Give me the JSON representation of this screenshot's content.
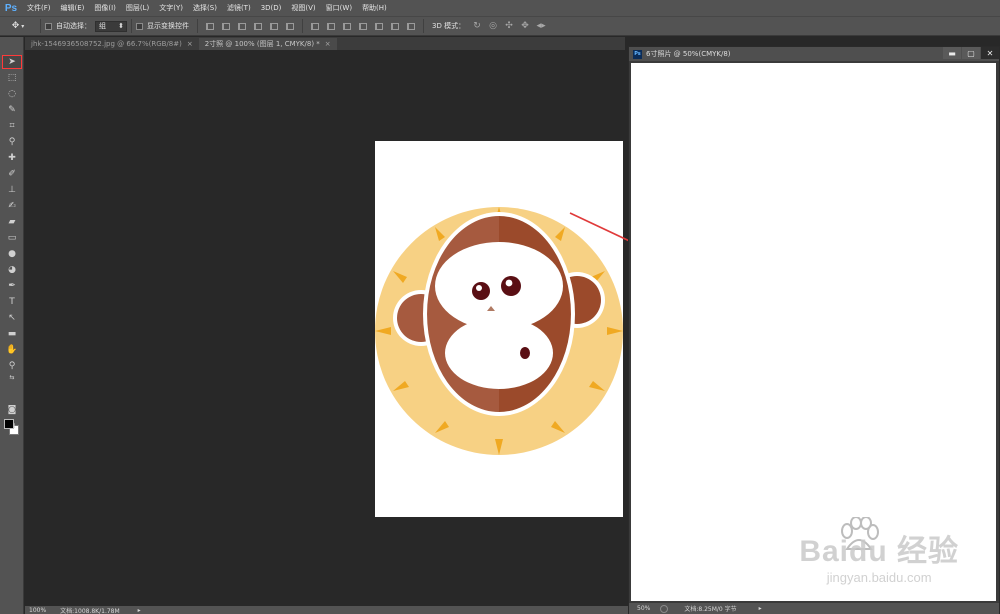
{
  "app": {
    "logo": "Ps",
    "menu": [
      "文件(F)",
      "编辑(E)",
      "图像(I)",
      "图层(L)",
      "文字(Y)",
      "选择(S)",
      "滤镜(T)",
      "3D(D)",
      "视图(V)",
      "窗口(W)",
      "帮助(H)"
    ]
  },
  "options": {
    "auto_select_label": "自动选择：",
    "auto_select_value": "组",
    "show_transform_label": "显示变换控件",
    "mode3d_label": "3D 模式："
  },
  "tabs": [
    {
      "label": "jhk-1546936508752.jpg @ 66.7%(RGB/8#)",
      "close": "×",
      "active": false
    },
    {
      "label": "2寸照 @ 100% (图层 1, CMYK/8) *",
      "close": "×",
      "active": true
    }
  ],
  "status": {
    "zoom": "100%",
    "doc": "文档:1008.8K/1.78M"
  },
  "float_window": {
    "title": "6寸照片 @ 50%(CMYK/8)",
    "zoom": "50%",
    "doc": "文档:8.25M/0 字节",
    "btn_min": "▬",
    "btn_max": "▢",
    "btn_close": "✕"
  },
  "watermark": {
    "main": "Baidu 经验",
    "sub": "jingyan.baidu.com"
  },
  "colors": {
    "accent_red": "#ff3a3a",
    "arrow_red": "#e03a3a",
    "monkey_dark": "#9b4a2b",
    "monkey_light": "#a65a3f",
    "badge_yellow": "#f7d184",
    "badge_ray": "#f0a922"
  }
}
